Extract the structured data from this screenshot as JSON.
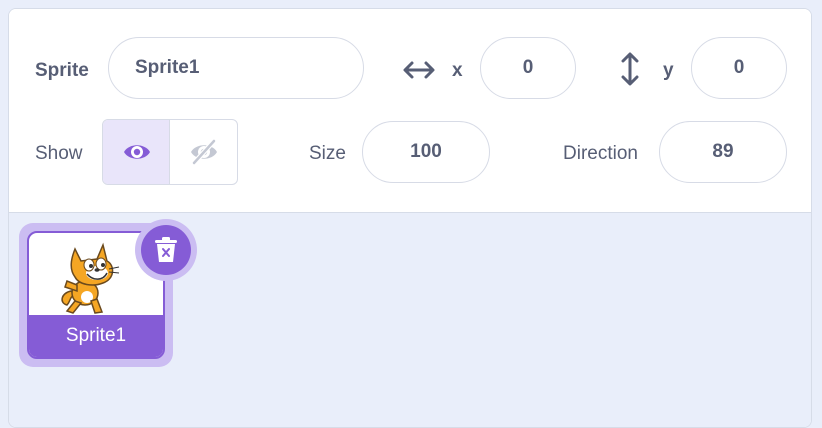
{
  "sprite_info": {
    "sprite_label": "Sprite",
    "sprite_name": "Sprite1",
    "x_label": "x",
    "x_value": "0",
    "y_label": "y",
    "y_value": "0",
    "show_label": "Show",
    "show_state": "visible",
    "size_label": "Size",
    "size_value": "100",
    "direction_label": "Direction",
    "direction_value": "89"
  },
  "sprites": [
    {
      "name": "Sprite1",
      "selected": true
    }
  ],
  "colors": {
    "accent": "#855cd6",
    "accent_light": "#cbbdf2",
    "text": "#575e75",
    "background": "#e9eefa"
  },
  "icons": [
    "horizontal-arrows-icon",
    "vertical-arrows-icon",
    "eye-icon",
    "eye-slash-icon",
    "trash-icon",
    "cat-sprite-thumbnail"
  ]
}
